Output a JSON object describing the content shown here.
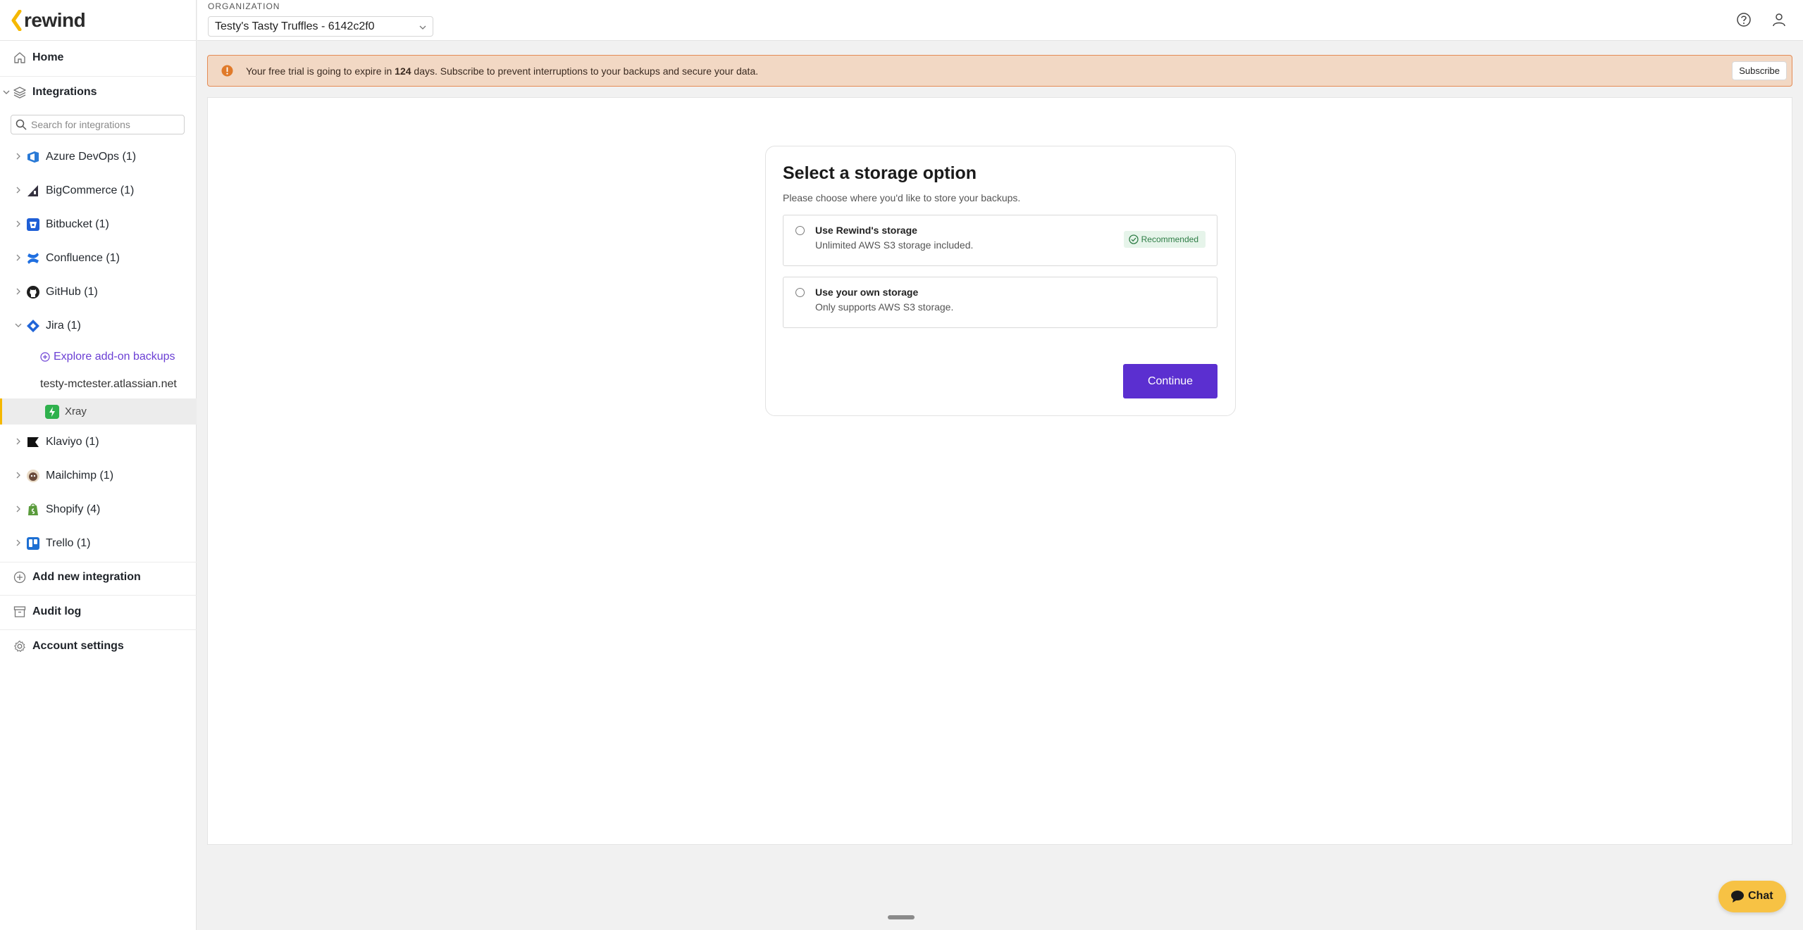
{
  "app": {
    "logo_text": "rewind",
    "colors": {
      "accent": "#5b2fd0",
      "logo": "#f5b800",
      "warning": "#e48b55",
      "success": "#2e7d46"
    }
  },
  "header": {
    "org_label": "ORGANIZATION",
    "org_value": "Testy's Tasty Truffles - 6142c2f0",
    "icons": [
      "help-icon",
      "user-icon"
    ]
  },
  "sidebar": {
    "home": "Home",
    "integrations": "Integrations",
    "search_placeholder": "Search for integrations",
    "items": [
      {
        "name": "Azure DevOps (1)",
        "icon": "azure-devops-icon"
      },
      {
        "name": "BigCommerce (1)",
        "icon": "bigcommerce-icon"
      },
      {
        "name": "Bitbucket (1)",
        "icon": "bitbucket-icon"
      },
      {
        "name": "Confluence (1)",
        "icon": "confluence-icon"
      },
      {
        "name": "GitHub (1)",
        "icon": "github-icon"
      },
      {
        "name": "Jira (1)",
        "icon": "jira-icon"
      },
      {
        "name": "Klaviyo (1)",
        "icon": "klaviyo-icon"
      },
      {
        "name": "Mailchimp (1)",
        "icon": "mailchimp-icon"
      },
      {
        "name": "Shopify (4)",
        "icon": "shopify-icon"
      },
      {
        "name": "Trello (1)",
        "icon": "trello-icon"
      }
    ],
    "jira_children": {
      "explore": "Explore add-on backups",
      "site": "testy-mctester.atlassian.net",
      "addon": "Xray"
    },
    "add_new": "Add new integration",
    "audit_log": "Audit log",
    "account_settings": "Account settings"
  },
  "banner": {
    "msg_pre": "Your free trial is going to expire in ",
    "days": "124",
    "msg_post": " days. Subscribe to prevent interruptions to your backups and secure your data.",
    "subscribe": "Subscribe"
  },
  "storage": {
    "title": "Select a storage option",
    "subtitle": "Please choose where you'd like to store your backups.",
    "options": [
      {
        "title": "Use Rewind's storage",
        "desc": "Unlimited AWS S3 storage included.",
        "badge": "Recommended"
      },
      {
        "title": "Use your own storage",
        "desc": "Only supports AWS S3 storage."
      }
    ],
    "continue": "Continue"
  },
  "chat": {
    "label": "Chat"
  }
}
